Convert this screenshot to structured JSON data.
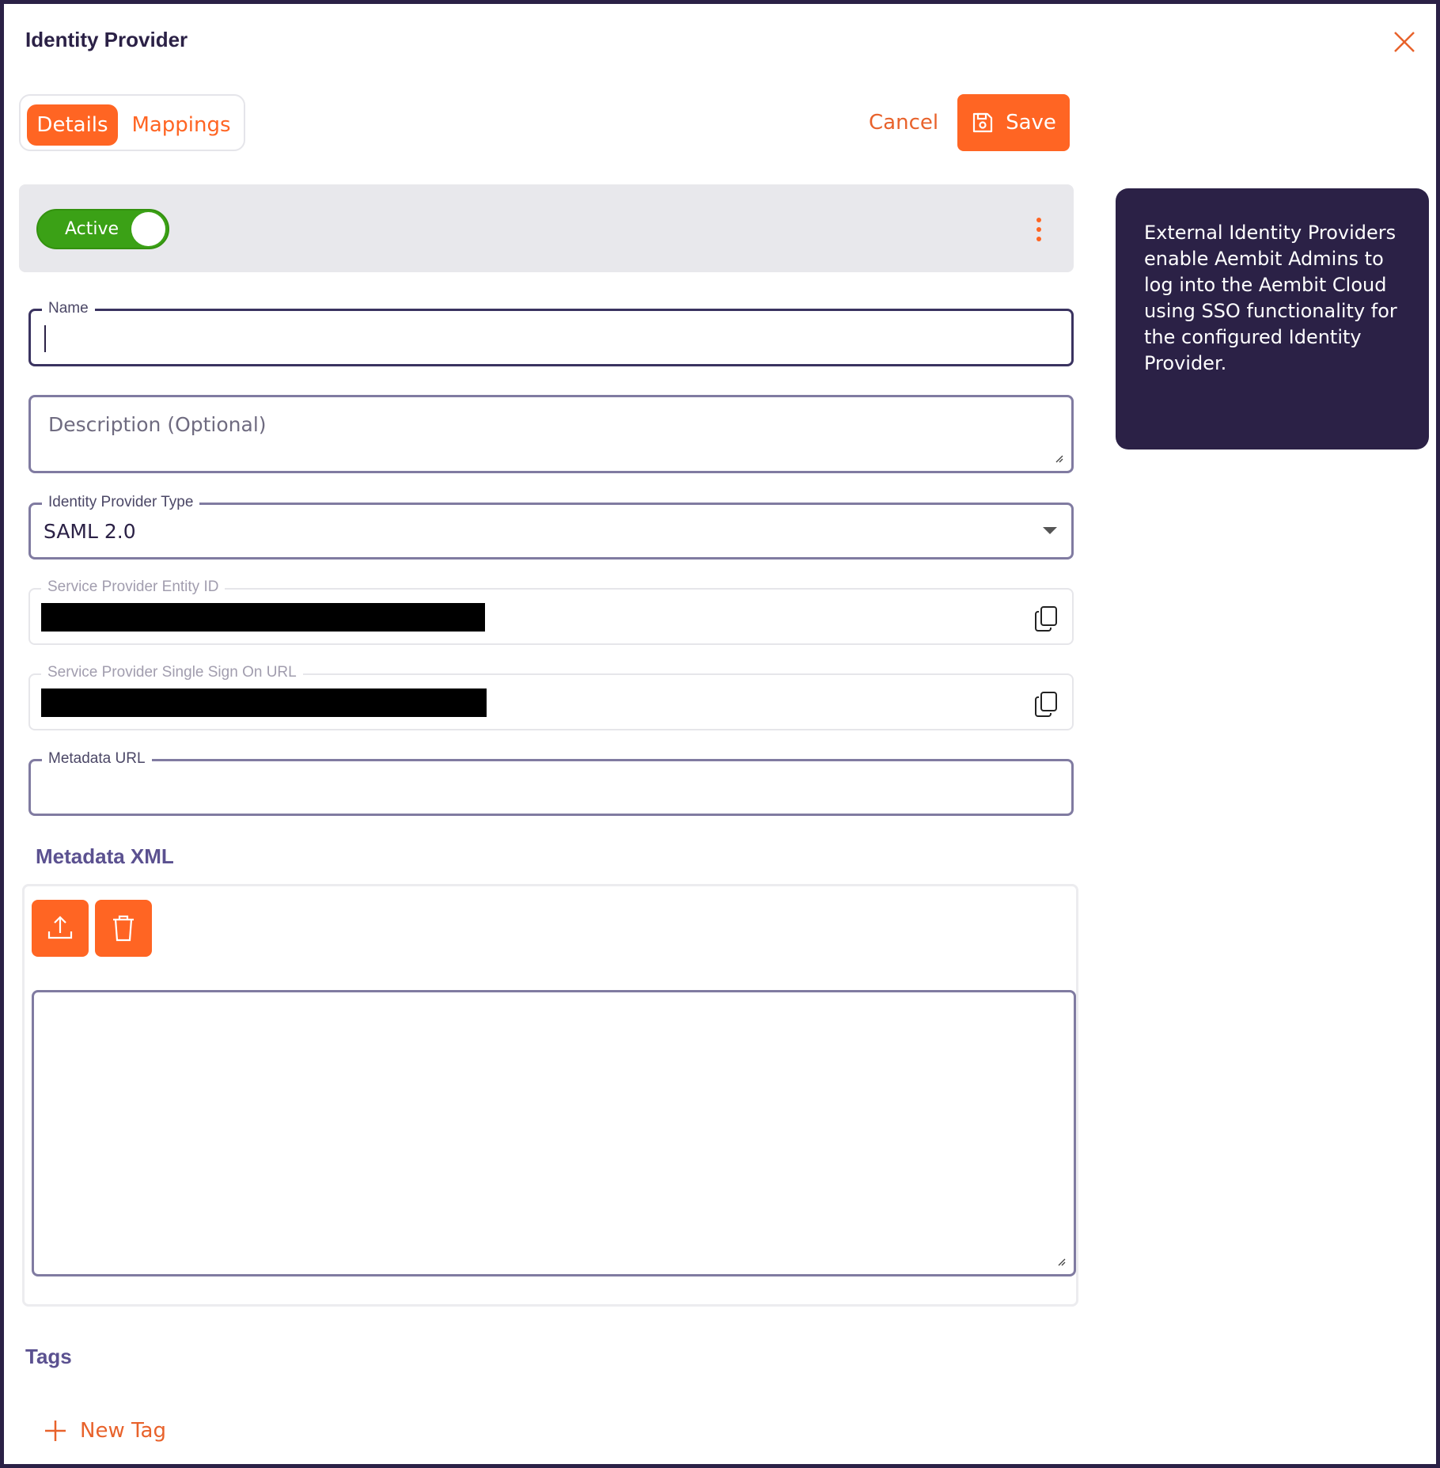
{
  "dialog": {
    "title": "Identity Provider"
  },
  "tabs": [
    {
      "label": "Details"
    },
    {
      "label": "Mappings"
    }
  ],
  "toolbar": {
    "cancel_label": "Cancel",
    "save_label": "Save"
  },
  "status": {
    "toggle_label": "Active"
  },
  "form": {
    "name": {
      "label": "Name",
      "value": ""
    },
    "description": {
      "placeholder": "Description (Optional)"
    },
    "idp_type": {
      "label": "Identity Provider Type",
      "value": "SAML 2.0"
    },
    "sp_entity_id": {
      "label": "Service Provider Entity ID"
    },
    "sp_sso_url": {
      "label": "Service Provider Single Sign On URL"
    },
    "metadata_url": {
      "label": "Metadata URL",
      "value": ""
    }
  },
  "metadata_xml": {
    "title": "Metadata XML"
  },
  "tags": {
    "title": "Tags",
    "new_tag_label": "New Tag"
  },
  "info": {
    "text": "External Identity Providers enable Aembit Admins to log into the Aembit Cloud using SSO functionality for the configured Identity Provider."
  },
  "colors": {
    "accent": "#ff6523",
    "primary_dark": "#2b2146",
    "active_green": "#3ba116"
  }
}
